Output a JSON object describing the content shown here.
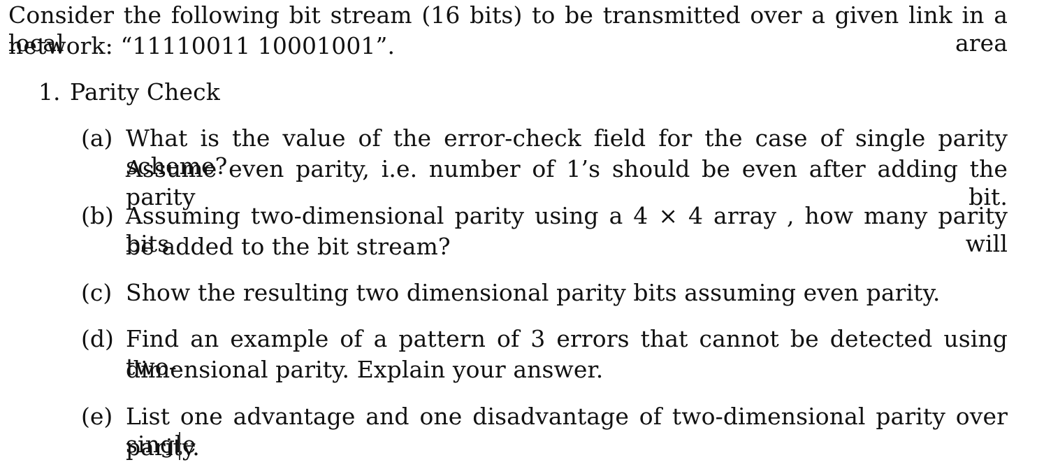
{
  "intro": {
    "line1": "Consider the following bit stream (16 bits) to be transmitted over a given link in a local area",
    "line2": "network: “11110011 10001001”."
  },
  "section": {
    "number": "1.",
    "title": "Parity Check"
  },
  "items": [
    {
      "label": "(a)",
      "line1": "What is the value of the error-check field for the case of single parity scheme?",
      "line2": "Assume even parity, i.e. number of 1’s should be even after adding the parity bit."
    },
    {
      "label": "(b)",
      "line1": "Assuming two-dimensional parity using a 4 × 4 array , how many parity bits will",
      "line2": "be added to the bit stream?"
    },
    {
      "label": "(c)",
      "line1": "Show the resulting two dimensional parity bits assuming even parity."
    },
    {
      "label": "(d)",
      "line1": "Find an example of a pattern of 3 errors that cannot be detected using two-",
      "line2": "dimensional parity. Explain your answer."
    },
    {
      "label": "(e)",
      "line1": "List one advantage and one disadvantage of two-dimensional parity over single",
      "line2": "parity."
    }
  ]
}
